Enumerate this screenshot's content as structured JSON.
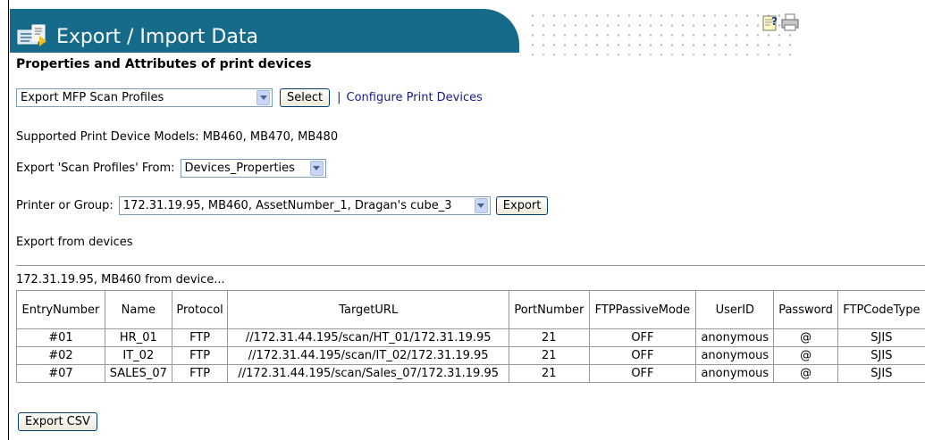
{
  "banner": {
    "title": "Export / Import Data"
  },
  "subtitle": "Properties and Attributes of print devices",
  "export_type": {
    "selected": "Export MFP Scan Profiles",
    "select_label": "Select",
    "configure_link": "Configure Print Devices"
  },
  "supported_models": "Supported Print Device Models: MB460, MB470, MB480",
  "export_from": {
    "label": "Export 'Scan Profiles' From:",
    "selected": "Devices_Properties"
  },
  "printer_group": {
    "label": "Printer or Group:",
    "selected": "172.31.19.95, MB460, AssetNumber_1, Dragan's cube_3",
    "export_label": "Export"
  },
  "export_from_devices": "Export from devices",
  "device_caption": "172.31.19.95, MB460 from device...",
  "table": {
    "headers": [
      "EntryNumber",
      "Name",
      "Protocol",
      "TargetURL",
      "PortNumber",
      "FTPPassiveMode",
      "UserID",
      "Password",
      "FTPCodeType"
    ],
    "rows": [
      [
        "#01",
        "HR_01",
        "FTP",
        "//172.31.44.195/scan/HT_01/172.31.19.95",
        "21",
        "OFF",
        "anonymous",
        "@",
        "SJIS"
      ],
      [
        "#02",
        "IT_02",
        "FTP",
        "//172.31.44.195/scan/IT_02/172.31.19.95",
        "21",
        "OFF",
        "anonymous",
        "@",
        "SJIS"
      ],
      [
        "#07",
        "SALES_07",
        "FTP",
        "//172.31.44.195/scan/Sales_07/172.31.19.95",
        "21",
        "OFF",
        "anonymous",
        "@",
        "SJIS"
      ]
    ]
  },
  "export_csv_label": "Export CSV",
  "colors": {
    "banner": "#176b8a",
    "link": "#1a1a8c"
  }
}
